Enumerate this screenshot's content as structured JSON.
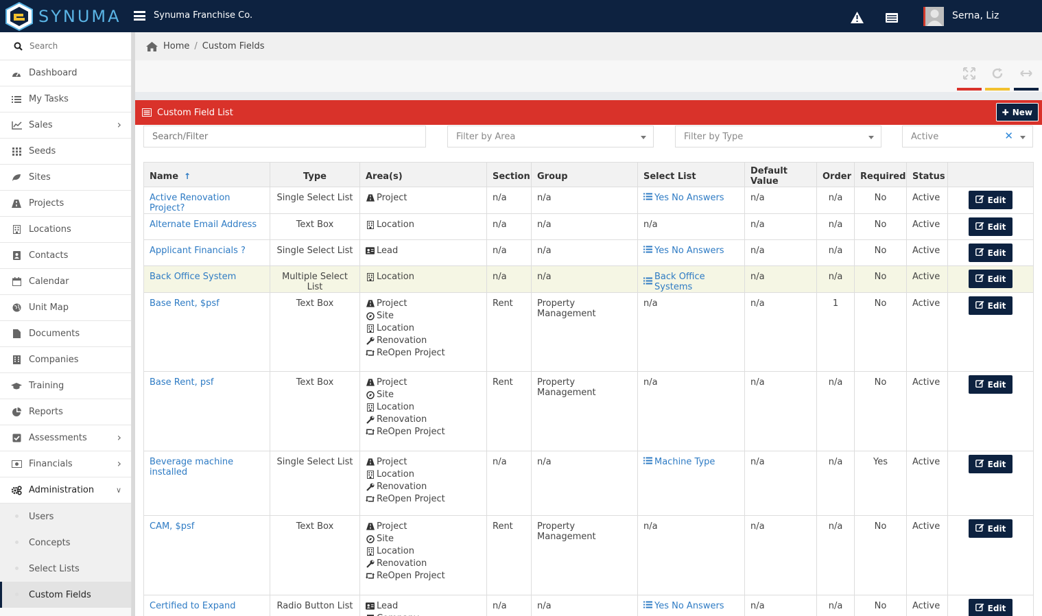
{
  "app": {
    "brand": "SYNUMA",
    "company": "Synuma Franchise Co.",
    "user_name": "Serna, Liz",
    "colors": {
      "navy": "#0d2240",
      "red": "#d9322a",
      "link": "#2e7bc4"
    }
  },
  "sidebar": {
    "search_placeholder": "Search",
    "items": [
      {
        "label": "Dashboard",
        "icon": "dashboard-icon"
      },
      {
        "label": "My Tasks",
        "icon": "tasks-icon"
      },
      {
        "label": "Sales",
        "icon": "chart-line-icon"
      },
      {
        "label": "Seeds",
        "icon": "grid-icon"
      },
      {
        "label": "Sites",
        "icon": "leaf-icon"
      },
      {
        "label": "Projects",
        "icon": "road-icon"
      },
      {
        "label": "Locations",
        "icon": "building-icon"
      },
      {
        "label": "Contacts",
        "icon": "contact-book-icon"
      },
      {
        "label": "Calendar",
        "icon": "calendar-icon"
      },
      {
        "label": "Unit Map",
        "icon": "globe-icon"
      },
      {
        "label": "Documents",
        "icon": "file-icon"
      },
      {
        "label": "Companies",
        "icon": "office-icon"
      },
      {
        "label": "Training",
        "icon": "graduation-cap-icon"
      },
      {
        "label": "Reports",
        "icon": "pie-chart-icon"
      },
      {
        "label": "Assessments",
        "icon": "check-square-icon"
      },
      {
        "label": "Financials",
        "icon": "money-icon"
      },
      {
        "label": "Administration",
        "icon": "cogs-icon"
      }
    ],
    "sub_items": [
      {
        "label": "Users"
      },
      {
        "label": "Concepts"
      },
      {
        "label": "Select Lists"
      },
      {
        "label": "Custom Fields"
      }
    ]
  },
  "breadcrumb": {
    "home": "Home",
    "current": "Custom Fields"
  },
  "panel": {
    "title": "Custom Field List",
    "new_label": "New"
  },
  "filters": {
    "search_placeholder": "Search/Filter",
    "area": "Filter by Area",
    "type": "Filter by Type",
    "status": "Active"
  },
  "table": {
    "headers": {
      "name": "Name",
      "type": "Type",
      "areas": "Area(s)",
      "section": "Section",
      "group": "Group",
      "select_list": "Select List",
      "default_value": "Default Value",
      "order": "Order",
      "required": "Required",
      "status": "Status"
    },
    "edit_label": "Edit",
    "rows": [
      {
        "name": "Active Renovation Project?",
        "type": "Single Select List",
        "areas": [
          "Project"
        ],
        "section": "n/a",
        "group": "n/a",
        "select_list": "Yes No Answers",
        "default_value": "n/a",
        "order": "n/a",
        "required": "No",
        "status": "Active"
      },
      {
        "name": "Alternate Email Address",
        "type": "Text Box",
        "areas": [
          "Location"
        ],
        "section": "n/a",
        "group": "n/a",
        "select_list": "n/a",
        "default_value": "n/a",
        "order": "n/a",
        "required": "No",
        "status": "Active"
      },
      {
        "name": "Applicant Financials ?",
        "type": "Single Select List",
        "areas": [
          "Lead"
        ],
        "section": "n/a",
        "group": "n/a",
        "select_list": "Yes No Answers",
        "default_value": "n/a",
        "order": "n/a",
        "required": "No",
        "status": "Active"
      },
      {
        "name": "Back Office System",
        "type": "Multiple Select List",
        "areas": [
          "Location"
        ],
        "section": "n/a",
        "group": "n/a",
        "select_list": "Back Office Systems",
        "default_value": "n/a",
        "order": "n/a",
        "required": "No",
        "status": "Active",
        "highlight": true
      },
      {
        "name": "Base Rent, $psf",
        "type": "Text Box",
        "areas": [
          "Project",
          "Site",
          "Location",
          "Renovation",
          "ReOpen Project"
        ],
        "section": "Rent",
        "group": "Property Management",
        "select_list": "n/a",
        "default_value": "n/a",
        "order": "1",
        "required": "No",
        "status": "Active"
      },
      {
        "name": "Base Rent, psf",
        "type": "Text Box",
        "areas": [
          "Project",
          "Site",
          "Location",
          "Renovation",
          "ReOpen Project"
        ],
        "section": "Rent",
        "group": "Property Management",
        "select_list": "n/a",
        "default_value": "n/a",
        "order": "n/a",
        "required": "No",
        "status": "Active"
      },
      {
        "name": "Beverage machine installed",
        "type": "Single Select List",
        "areas": [
          "Project",
          "Location",
          "Renovation",
          "ReOpen Project"
        ],
        "section": "n/a",
        "group": "n/a",
        "select_list": "Machine Type",
        "default_value": "n/a",
        "order": "n/a",
        "required": "Yes",
        "status": "Active"
      },
      {
        "name": "CAM, $psf",
        "type": "Text Box",
        "areas": [
          "Project",
          "Site",
          "Location",
          "Renovation",
          "ReOpen Project"
        ],
        "section": "Rent",
        "group": "Property Management",
        "select_list": "n/a",
        "default_value": "n/a",
        "order": "n/a",
        "required": "No",
        "status": "Active"
      },
      {
        "name": "Certified to Expand",
        "type": "Radio Button List",
        "areas": [
          "Lead",
          "Company"
        ],
        "section": "n/a",
        "group": "n/a",
        "select_list": "Yes No Answers",
        "default_value": "n/a",
        "order": "n/a",
        "required": "No",
        "status": "Active"
      }
    ]
  }
}
